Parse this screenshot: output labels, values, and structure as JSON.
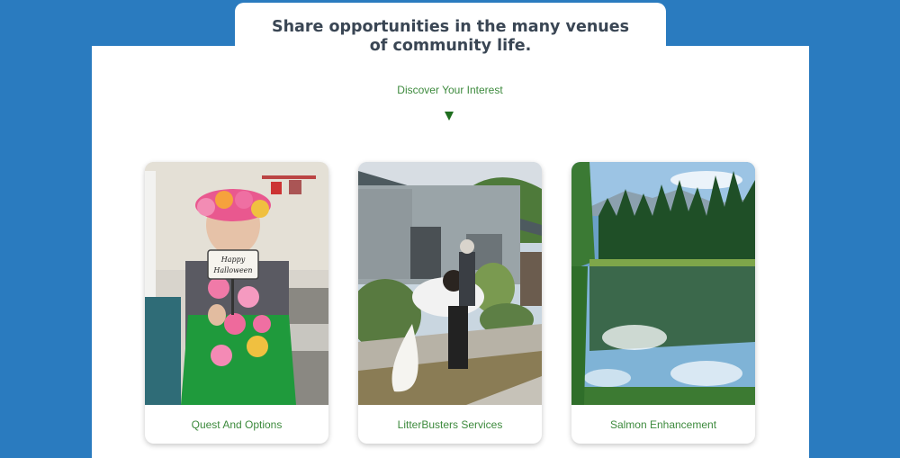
{
  "header": {
    "title": "Share opportunities in the many venues of community life."
  },
  "section": {
    "subtitle": "Discover Your Interest"
  },
  "cards": [
    {
      "caption": "Quest And Options",
      "image_sign_text": "Happy Halloween"
    },
    {
      "caption": "LitterBusters Services"
    },
    {
      "caption": "Salmon Enhancement"
    }
  ],
  "colors": {
    "background": "#2a7bbf",
    "panel": "#ffffff",
    "title": "#3a4654",
    "accent_green": "#3d8a3d"
  }
}
